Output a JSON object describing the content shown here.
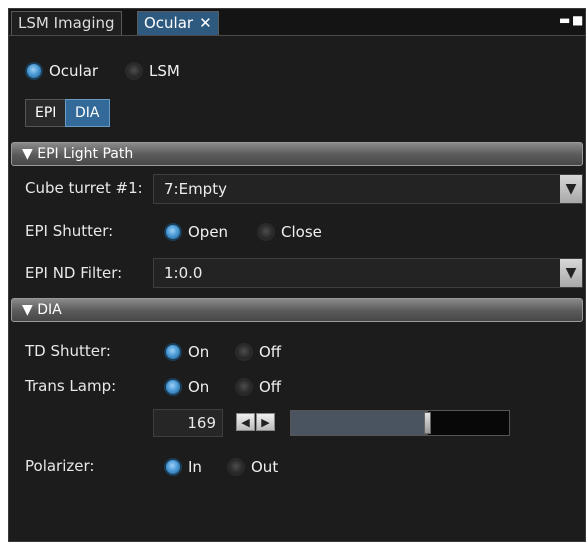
{
  "tabs": [
    {
      "label": "LSM Imaging",
      "active": false
    },
    {
      "label": "Ocular",
      "active": true,
      "close_glyph": "✕"
    }
  ],
  "window_controls": {
    "minimize": "▬",
    "maximize": "■"
  },
  "mode": {
    "options": [
      "Ocular",
      "LSM"
    ],
    "selected": "Ocular"
  },
  "illumination_buttons": [
    {
      "label": "EPI",
      "active": false
    },
    {
      "label": "DIA",
      "active": true
    }
  ],
  "epi_section": {
    "title": "▼ EPI Light Path",
    "cube_turret": {
      "label": "Cube turret #1:",
      "value": "7:Empty"
    },
    "epi_shutter": {
      "label": "EPI Shutter:",
      "options": [
        "Open",
        "Close"
      ],
      "selected": "Open"
    },
    "epi_nd_filter": {
      "label": "EPI ND Filter:",
      "value": "1:0.0"
    }
  },
  "dia_section": {
    "title": "▼ DIA",
    "td_shutter": {
      "label": "TD Shutter:",
      "options": [
        "On",
        "Off"
      ],
      "selected": "On"
    },
    "trans_lamp": {
      "label": "Trans Lamp:",
      "options": [
        "On",
        "Off"
      ],
      "selected": "On",
      "intensity": "169",
      "intensity_fraction": 0.63
    },
    "polarizer": {
      "label": "Polarizer:",
      "options": [
        "In",
        "Out"
      ],
      "selected": "In"
    }
  },
  "colors": {
    "accent": "#336a99",
    "panel_bg": "#1c1c1c",
    "radio_on": "#4b9ad6"
  },
  "icons": {
    "dropdown": "▼",
    "step_left": "◀",
    "step_right": "▶"
  }
}
